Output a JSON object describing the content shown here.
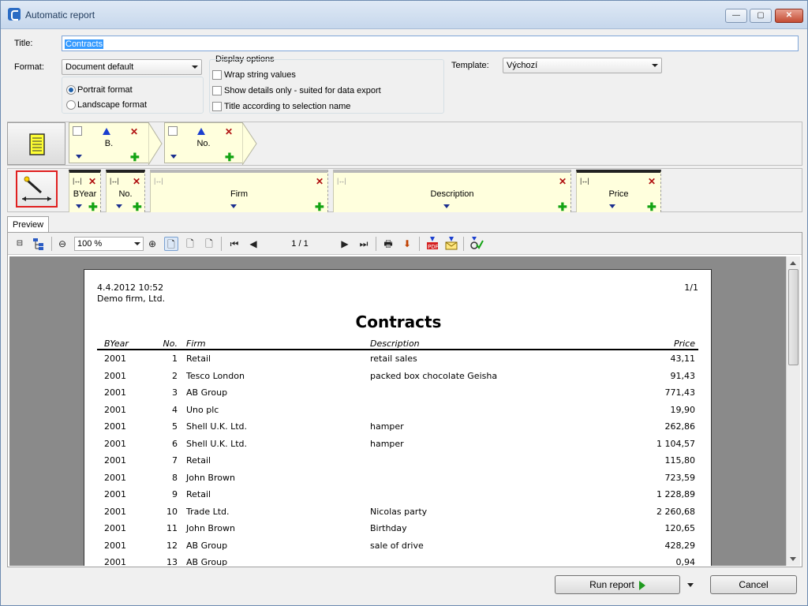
{
  "window": {
    "title": "Automatic report",
    "minimize_label": "—",
    "maximize_label": "▢",
    "close_label": "✕"
  },
  "form": {
    "title_label": "Title:",
    "title_value": "Contracts",
    "format_label": "Format:",
    "format_value": "Document default",
    "portrait_label": "Portrait format",
    "landscape_label": "Landscape format",
    "display_options_label": "Display options",
    "wrap_label": "Wrap string values",
    "details_label": "Show details only - suited for data export",
    "title_selection_label": "Title according to selection name",
    "template_label": "Template:",
    "template_value": "Výchozí"
  },
  "groups": [
    {
      "label": "B."
    },
    {
      "label": "No."
    }
  ],
  "columns": [
    {
      "label": "BYear"
    },
    {
      "label": "No."
    },
    {
      "label": "Firm"
    },
    {
      "label": "Description"
    },
    {
      "label": "Price"
    }
  ],
  "preview": {
    "tab_label": "Preview",
    "zoom": "100 %",
    "page_info": "1 / 1"
  },
  "report": {
    "datetime": "4.4.2012 10:52",
    "company": "Demo firm, Ltd.",
    "page": "1/1",
    "title": "Contracts",
    "headers": {
      "byear": "BYear",
      "no": "No.",
      "firm": "Firm",
      "description": "Description",
      "price": "Price"
    },
    "rows": [
      {
        "byear": "2001",
        "no": "1",
        "firm": "Retail",
        "description": "retail sales",
        "price": "43,11"
      },
      {
        "byear": "2001",
        "no": "2",
        "firm": "Tesco London",
        "description": "packed box chocolate Geisha",
        "price": "91,43"
      },
      {
        "byear": "2001",
        "no": "3",
        "firm": "AB Group",
        "description": "",
        "price": "771,43"
      },
      {
        "byear": "2001",
        "no": "4",
        "firm": "Uno plc",
        "description": "",
        "price": "19,90"
      },
      {
        "byear": "2001",
        "no": "5",
        "firm": "Shell U.K. Ltd.",
        "description": "hamper",
        "price": "262,86"
      },
      {
        "byear": "2001",
        "no": "6",
        "firm": "Shell U.K. Ltd.",
        "description": "hamper",
        "price": "1 104,57"
      },
      {
        "byear": "2001",
        "no": "7",
        "firm": "Retail",
        "description": "",
        "price": "115,80"
      },
      {
        "byear": "2001",
        "no": "8",
        "firm": "John Brown",
        "description": "",
        "price": "723,59"
      },
      {
        "byear": "2001",
        "no": "9",
        "firm": "Retail",
        "description": "",
        "price": "1 228,89"
      },
      {
        "byear": "2001",
        "no": "10",
        "firm": "Trade Ltd.",
        "description": "Nicolas party",
        "price": "2 260,68"
      },
      {
        "byear": "2001",
        "no": "11",
        "firm": "John Brown",
        "description": "Birthday",
        "price": "120,65"
      },
      {
        "byear": "2001",
        "no": "12",
        "firm": "AB Group",
        "description": "sale of drive",
        "price": "428,29"
      },
      {
        "byear": "2001",
        "no": "13",
        "firm": "AB Group",
        "description": "",
        "price": "0,94"
      }
    ]
  },
  "buttons": {
    "run": "Run report",
    "cancel": "Cancel"
  }
}
